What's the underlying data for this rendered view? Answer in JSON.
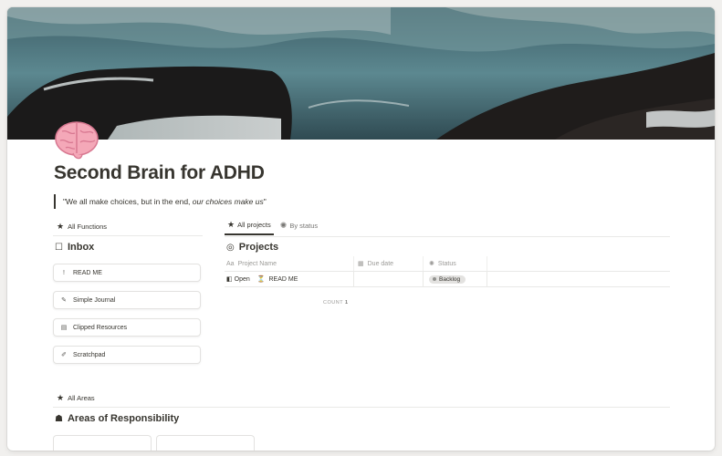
{
  "page": {
    "title": "Second Brain for ADHD",
    "quote_start": "\"We all make choices, but in the end, ",
    "quote_em": "our choices make us",
    "quote_end": "\"",
    "icon": "brain-icon"
  },
  "functions": {
    "label": "All Functions",
    "inbox_heading": "Inbox",
    "items": [
      {
        "label": "READ ME",
        "icon": "exclamation-icon"
      },
      {
        "label": "Simple Journal",
        "icon": "pencil-icon"
      },
      {
        "label": "Clipped Resources",
        "icon": "archive-icon"
      },
      {
        "label": "Scratchpad",
        "icon": "edit-icon"
      }
    ]
  },
  "projects": {
    "tabs": [
      {
        "label": "All projects",
        "active": true
      },
      {
        "label": "By status",
        "active": false
      }
    ],
    "heading": "Projects",
    "columns": [
      "Project Name",
      "Due date",
      "Status"
    ],
    "rows": [
      {
        "open": "Open",
        "name": "READ ME",
        "due": "",
        "status": "Backlog"
      }
    ],
    "count_label": "COUNT",
    "count_value": "1"
  },
  "areas": {
    "label": "All Areas",
    "heading": "Areas of Responsibility"
  },
  "colors": {
    "text": "#37352f",
    "muted": "#9b9a97",
    "border": "#e9e9e7",
    "badge_bg": "#e3e2e0",
    "cover_sea": "#4f7c83"
  }
}
